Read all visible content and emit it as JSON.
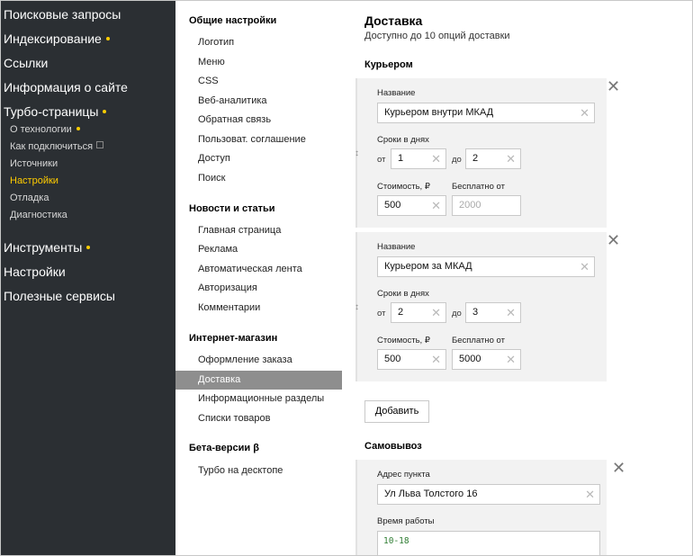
{
  "sidebar": {
    "search_queries": "Поисковые запросы",
    "indexing": "Индексирование",
    "links": "Ссылки",
    "site_info": "Информация о сайте",
    "turbo_pages": "Турбо-страницы",
    "turbo_sub": {
      "about": "О технологии",
      "how_to_connect": "Как подключиться",
      "sources": "Источники",
      "settings": "Настройки",
      "debug": "Отладка",
      "diagnostics": "Диагностика"
    },
    "tools": "Инструменты",
    "settings": "Настройки",
    "useful_services": "Полезные сервисы",
    "accent_color": "#ffcc00"
  },
  "menu": {
    "general_heading": "Общие настройки",
    "general_items": [
      "Логотип",
      "Меню",
      "CSS",
      "Веб-аналитика",
      "Обратная связь",
      "Пользоват. соглашение",
      "Доступ",
      "Поиск"
    ],
    "news_heading": "Новости и статьи",
    "news_items": [
      "Главная страница",
      "Реклама",
      "Автоматическая лента",
      "Авторизация",
      "Комментарии"
    ],
    "shop_heading": "Интернет-магазин",
    "shop_items": [
      "Оформление заказа",
      "Доставка",
      "Информационные разделы",
      "Списки товаров"
    ],
    "beta_heading": "Бета-версии β",
    "beta_items": [
      "Турбо на десктопе"
    ]
  },
  "content": {
    "title": "Доставка",
    "subtitle": "Доступно до 10 опций доставки",
    "courier_heading": "Курьером",
    "courier_options": [
      {
        "name_label": "Название",
        "name_value": "Курьером внутри МКАД",
        "days_label": "Сроки в днях",
        "from_label": "от",
        "from_value": "1",
        "to_label": "до",
        "to_value": "2",
        "cost_label": "Стоимость, ₽",
        "cost_value": "500",
        "free_label": "Бесплатно от",
        "free_value": "2000"
      },
      {
        "name_label": "Название",
        "name_value": "Курьером за МКАД",
        "days_label": "Сроки в днях",
        "from_label": "от",
        "from_value": "2",
        "to_label": "до",
        "to_value": "3",
        "cost_label": "Стоимость, ₽",
        "cost_value": "500",
        "free_label": "Бесплатно от",
        "free_value": "5000"
      }
    ],
    "add_button": "Добавить",
    "pickup_heading": "Самовывоз",
    "pickup": {
      "address_label": "Адрес пункта",
      "address_value": "Ул Льва Толстого 16",
      "hours_label": "Время работы",
      "hours_value": "10-18"
    },
    "clear_glyph": "✕",
    "remove_glyph": "✕",
    "drag_glyph": "↕"
  }
}
